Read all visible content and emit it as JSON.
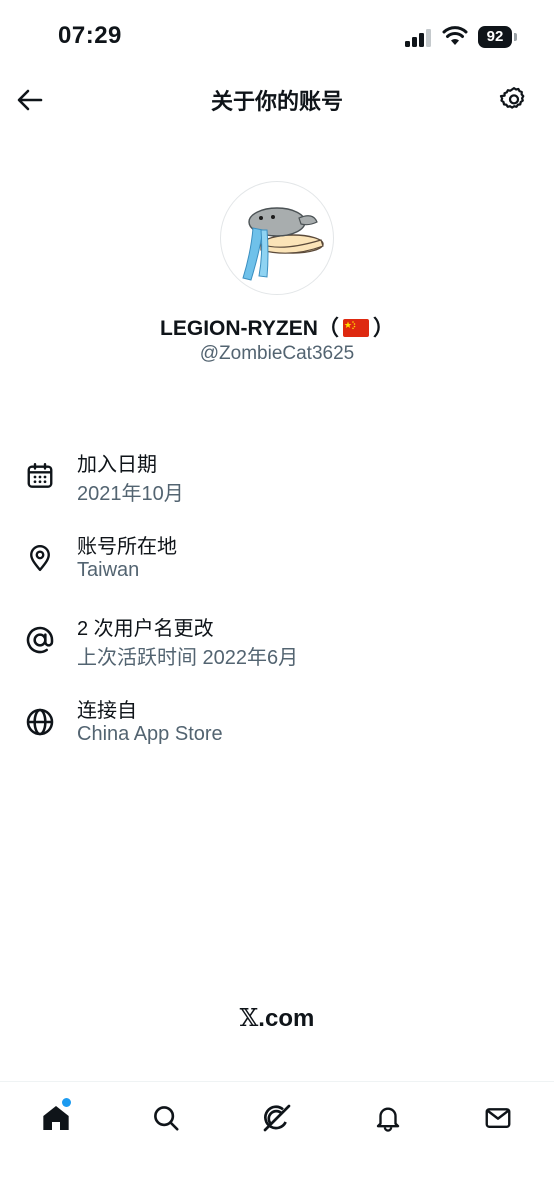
{
  "status_bar": {
    "time": "07:29",
    "battery": "92"
  },
  "header": {
    "title": "关于你的账号",
    "back_icon": "back-arrow-icon",
    "settings_icon": "gear-icon"
  },
  "profile": {
    "display_name_prefix": "LEGION-RYZEN（",
    "display_name_suffix": "）",
    "flag": "china-flag",
    "handle": "@ZombieCat3625"
  },
  "info": [
    {
      "icon": "calendar-icon",
      "title": "加入日期",
      "value": "2021年10月"
    },
    {
      "icon": "location-pin-icon",
      "title": "账号所在地",
      "value": "Taiwan"
    },
    {
      "icon": "at-sign-icon",
      "title": "2 次用户名更改",
      "value": "上次活跃时间 2022年6月"
    },
    {
      "icon": "globe-icon",
      "title": "连接自",
      "value": "China App Store"
    }
  ],
  "footer": {
    "brand_mark": "𝕏",
    "brand_suffix": ".com"
  },
  "tabs": [
    {
      "name": "home",
      "icon": "home-icon",
      "has_notification": true
    },
    {
      "name": "search",
      "icon": "search-icon"
    },
    {
      "name": "grok",
      "icon": "grok-icon"
    },
    {
      "name": "notifications",
      "icon": "bell-icon"
    },
    {
      "name": "messages",
      "icon": "mail-icon"
    }
  ],
  "colors": {
    "text": "#0f1419",
    "secondary": "#536471",
    "accent": "#1d9bf0"
  }
}
